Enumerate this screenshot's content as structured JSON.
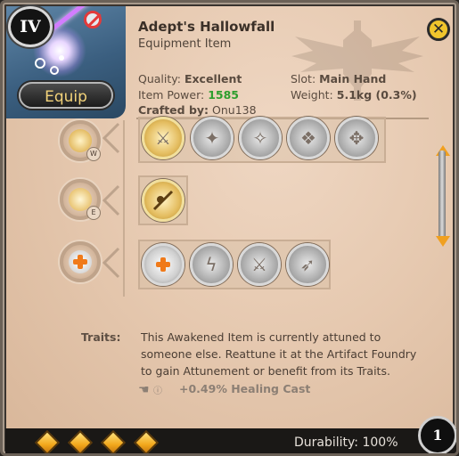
{
  "header": {
    "tier": "IV",
    "item_name": "Adept's Hallowfall",
    "item_type": "Equipment Item",
    "equip_label": "Equip"
  },
  "stats": {
    "quality_label": "Quality:",
    "quality_value": "Excellent",
    "item_power_label": "Item Power:",
    "item_power_value": "1585",
    "crafted_by_label": "Crafted by:",
    "crafted_by_value": "Onu138",
    "slot_label": "Slot:",
    "slot_value": "Main Hand",
    "weight_label": "Weight:",
    "weight_value": "5.1kg (0.3%)"
  },
  "tree_nodes": [
    {
      "tag": "W",
      "icon": "gold-rune-icon"
    },
    {
      "tag": "E",
      "icon": "gold-spear-icon"
    },
    {
      "tag": "",
      "icon": "heal-plus-icon"
    }
  ],
  "spell_rows": [
    {
      "icons": [
        "gold-spell-icon",
        "grey-spell-icon",
        "grey-spell-icon",
        "grey-spell-icon",
        "grey-spell-icon"
      ]
    },
    {
      "icons": [
        "gold-lunge-icon"
      ]
    },
    {
      "icons": [
        "heal-plus-icon",
        "lightning-icon",
        "sword-icon",
        "dash-icon"
      ]
    }
  ],
  "traits": {
    "label": "Traits:",
    "text": "This Awakened Item is currently attuned to someone else. Reattune it at the Artifact Foundry to gain Attunement or benefit from its Traits.",
    "bonus": "+0.49% Healing Cast"
  },
  "footer": {
    "enchant_gems": 4,
    "durability": "Durability: 100%",
    "stack_count": "1"
  },
  "colors": {
    "accent_gold": "#f0c52c",
    "power_green": "#2e9e2e",
    "gem_orange": "#f2a81c"
  }
}
